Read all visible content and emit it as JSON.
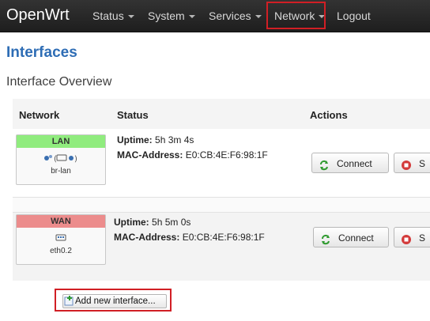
{
  "app": {
    "brand": "OpenWrt"
  },
  "nav": {
    "items": [
      {
        "label": "Status"
      },
      {
        "label": "System"
      },
      {
        "label": "Services"
      },
      {
        "label": "Network"
      },
      {
        "label": "Logout"
      }
    ]
  },
  "page": {
    "title": "Interfaces",
    "section": "Interface Overview"
  },
  "table": {
    "headers": {
      "network": "Network",
      "status": "Status",
      "actions": "Actions"
    },
    "rows": [
      {
        "name": "LAN",
        "device": "br-lan",
        "uptime_label": "Uptime:",
        "uptime": "5h 3m 4s",
        "mac_label": "MAC-Address:",
        "mac": "E0:CB:4E:F6:98:1F",
        "connect_label": "Connect",
        "stop_label": "S"
      },
      {
        "name": "WAN",
        "device": "eth0.2",
        "uptime_label": "Uptime:",
        "uptime": "5h 5m 0s",
        "mac_label": "MAC-Address:",
        "mac": "E0:CB:4E:F6:98:1F",
        "connect_label": "Connect",
        "stop_label": "S"
      }
    ]
  },
  "add_interface": {
    "label": "Add new interface..."
  },
  "colors": {
    "lan": "#90ec7e",
    "wan": "#ec8c8c",
    "title": "#2e6db5",
    "highlight": "#d11f25"
  }
}
